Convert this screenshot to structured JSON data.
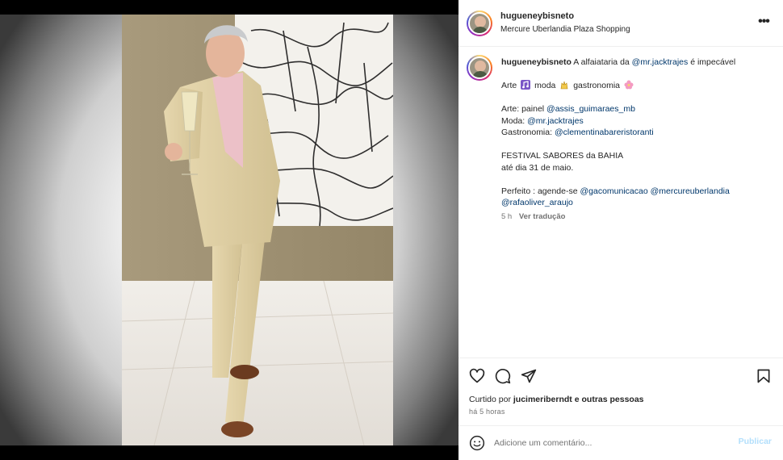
{
  "post": {
    "username": "hugueneybisneto",
    "location": "Mercure Uberlandia Plaza Shopping",
    "more_options": "•••"
  },
  "caption": {
    "username": "hugueneybisneto",
    "line1_text": "A alfaiataria da",
    "line1_mention": "@mr.jacktrajes",
    "line1_end": "é impecável",
    "line2_part1": "Arte",
    "line2_part2": "moda",
    "line2_part3": "gastronomia",
    "arte_label": "Arte: painel",
    "arte_mention": "@assis_guimaraes_mb",
    "moda_label": "Moda:",
    "moda_mention": "@mr.jacktrajes",
    "gastronomia_label": "Gastronomia:",
    "gastronomia_mention": "@clementinabareristoranti",
    "festival_line": "FESTIVAL SABORES da BAHIA",
    "date_line": "até dia 31 de maio.",
    "perfeito_label": "Perfeito : agende-se",
    "perfeito_mention1": "@gacomunicacao",
    "perfeito_mention2": "@mercureuberlandia",
    "perfeito_mention3": "@rafaoliver_araujo",
    "age": "5 h",
    "translate": "Ver tradução"
  },
  "icons": {
    "like": "heart-icon",
    "comment": "comment-bubble-icon",
    "share": "paper-plane-icon",
    "save": "bookmark-icon",
    "emoji": "smiley-icon",
    "more": "more-options-icon"
  },
  "likes": {
    "prefix": "Curtido por",
    "user": "jucimeriberndt",
    "suffix": "e outras pessoas"
  },
  "timestamp": "há 5 horas",
  "comment_box": {
    "placeholder": "Adicione um comentário...",
    "publish_label": "Publicar"
  },
  "colors": {
    "mention": "#00376b",
    "publish_disabled": "#b2dffc",
    "secondary_text": "#737373"
  }
}
